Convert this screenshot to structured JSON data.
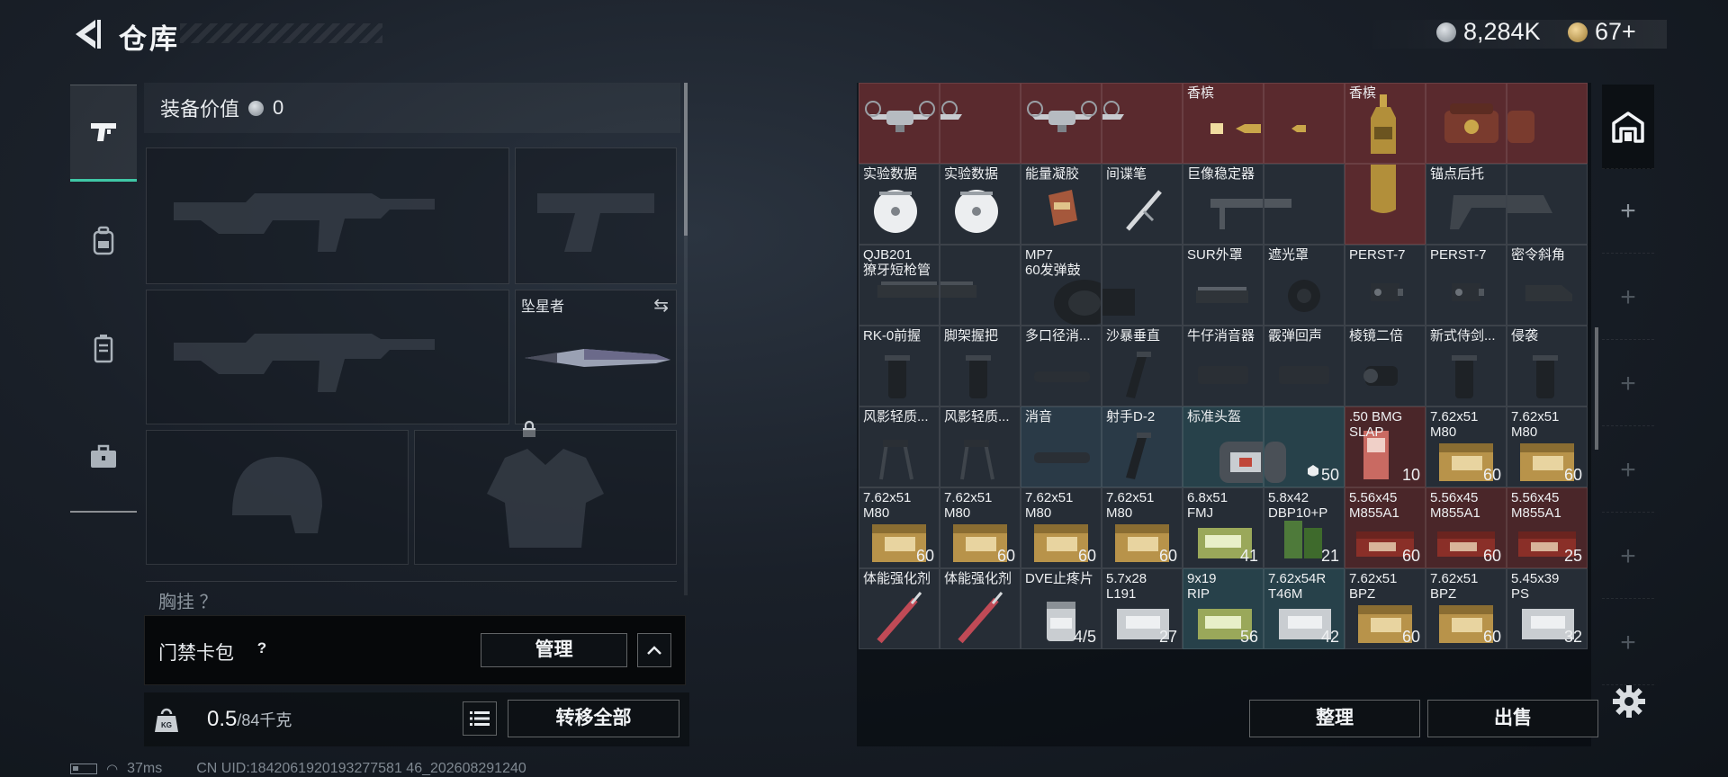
{
  "header": {
    "title": "仓库",
    "silver_amount": "8,284K",
    "gold_amount": "67+"
  },
  "nav": {
    "items": [
      {
        "icon": "pistol-icon",
        "active": true
      },
      {
        "icon": "backpack-icon",
        "active": false
      },
      {
        "icon": "vest-icon",
        "active": false
      },
      {
        "icon": "briefcase-icon",
        "active": false
      }
    ]
  },
  "loadout": {
    "equip_value_label": "装备价值",
    "equip_value": "0",
    "melee_name": "坠星者",
    "chest_rig_label": "胸挂 ？"
  },
  "keycard": {
    "label": "门禁卡包",
    "help": "?",
    "manage_label": "管理"
  },
  "weight": {
    "current": "0.5",
    "max": "/84千克"
  },
  "buttons": {
    "transfer_all": "转移全部",
    "sort": "整理",
    "sell": "出售"
  },
  "status": {
    "ping": "37ms",
    "uid": "CN UID:1842061920193277581 46_202608291240"
  },
  "stash": {
    "rows": [
      [
        {
          "name": "",
          "count": "",
          "bg": "red",
          "icon": "drone"
        },
        {
          "name": "",
          "count": "",
          "bg": "red",
          "icon": "drone-cont"
        },
        {
          "name": "",
          "count": "",
          "bg": "red",
          "icon": "drone"
        },
        {
          "name": "",
          "count": "",
          "bg": "red",
          "icon": "drone-cont"
        },
        {
          "name": "香槟",
          "count": "",
          "bg": "red",
          "icon": "bottle-h"
        },
        {
          "name": "",
          "count": "",
          "bg": "red",
          "icon": "bottle-h-cont"
        },
        {
          "name": "香槟",
          "count": "",
          "bg": "red",
          "icon": "bottle-v"
        },
        {
          "name": "",
          "count": "",
          "bg": "red",
          "icon": "box-red"
        },
        {
          "name": "",
          "count": "",
          "bg": "red",
          "icon": "box-red-cont"
        }
      ],
      [
        {
          "name": "实验数据",
          "count": "",
          "bg": "gray",
          "icon": "disc"
        },
        {
          "name": "实验数据",
          "count": "",
          "bg": "gray",
          "icon": "disc"
        },
        {
          "name": "能量凝胶",
          "count": "",
          "bg": "gray",
          "icon": "gel"
        },
        {
          "name": "间谍笔",
          "count": "",
          "bg": "gray",
          "icon": "pen"
        },
        {
          "name": "巨像稳定器",
          "count": "",
          "bg": "gray",
          "icon": "stabilizer"
        },
        {
          "name": "",
          "count": "",
          "bg": "gray",
          "icon": "stabilizer-cont"
        },
        {
          "name": "",
          "count": "",
          "bg": "red",
          "icon": "bottle-v-cont"
        },
        {
          "name": "锚点后托",
          "count": "",
          "bg": "gray",
          "icon": "stock"
        },
        {
          "name": "",
          "count": "",
          "bg": "gray",
          "icon": "stock-cont"
        }
      ],
      [
        {
          "name": "QJB201\n獠牙短枪管",
          "count": "",
          "bg": "gray",
          "icon": "handguard"
        },
        {
          "name": "",
          "count": "",
          "bg": "gray",
          "icon": "handguard-cont"
        },
        {
          "name": "MP7\n60发弹鼓",
          "count": "",
          "bg": "gray",
          "icon": "drum"
        },
        {
          "name": "",
          "count": "",
          "bg": "gray",
          "icon": "drum-cont"
        },
        {
          "name": "SUR外罩",
          "count": "",
          "bg": "gray",
          "icon": "rail"
        },
        {
          "name": "遮光罩",
          "count": "",
          "bg": "gray",
          "icon": "hood"
        },
        {
          "name": "PERST-7",
          "count": "",
          "bg": "gray",
          "icon": "laser"
        },
        {
          "name": "PERST-7",
          "count": "",
          "bg": "gray",
          "icon": "laser"
        },
        {
          "name": "密令斜角",
          "count": "",
          "bg": "gray",
          "icon": "angled"
        }
      ],
      [
        {
          "name": "RK-0前握",
          "count": "",
          "bg": "gray",
          "icon": "grip"
        },
        {
          "name": "脚架握把",
          "count": "",
          "bg": "gray",
          "icon": "grip"
        },
        {
          "name": "多口径消...",
          "count": "",
          "bg": "gray",
          "icon": "suppressor"
        },
        {
          "name": "沙暴垂直",
          "count": "",
          "bg": "gray",
          "icon": "vgrip"
        },
        {
          "name": "牛仔消音器",
          "count": "",
          "bg": "gray",
          "icon": "suppressor2"
        },
        {
          "name": "霰弹回声",
          "count": "",
          "bg": "gray",
          "icon": "suppressor2"
        },
        {
          "name": "棱镜二倍",
          "count": "",
          "bg": "gray",
          "icon": "scope"
        },
        {
          "name": "新式侍剑...",
          "count": "",
          "bg": "gray",
          "icon": "grip"
        },
        {
          "name": "侵袭",
          "count": "",
          "bg": "gray",
          "icon": "grip"
        }
      ],
      [
        {
          "name": "风影轻质...",
          "count": "",
          "bg": "gray",
          "icon": "bipod"
        },
        {
          "name": "风影轻质...",
          "count": "",
          "bg": "gray",
          "icon": "bipod"
        },
        {
          "name": "消音",
          "count": "",
          "bg": "blue",
          "icon": "suppressor"
        },
        {
          "name": "射手D-2",
          "count": "",
          "bg": "blue",
          "icon": "vgrip"
        },
        {
          "name": "标准头盔",
          "count": "",
          "bg": "teal",
          "icon": "helmet-bag"
        },
        {
          "name": "",
          "count": "50",
          "bg": "teal",
          "icon": "helmet-bag-cont"
        },
        {
          "name": ".50 BMG\nSLAP",
          "count": "10",
          "bg": "darkred",
          "icon": "ammo-red"
        },
        {
          "name": "7.62x51\nM80",
          "count": "60",
          "bg": "gray",
          "icon": "ammo-gold"
        },
        {
          "name": "7.62x51\nM80",
          "count": "60",
          "bg": "gray",
          "icon": "ammo-gold"
        }
      ],
      [
        {
          "name": "7.62x51\nM80",
          "count": "60",
          "bg": "gray",
          "icon": "ammo-gold"
        },
        {
          "name": "7.62x51\nM80",
          "count": "60",
          "bg": "gray",
          "icon": "ammo-gold"
        },
        {
          "name": "7.62x51\nM80",
          "count": "60",
          "bg": "gray",
          "icon": "ammo-gold"
        },
        {
          "name": "7.62x51\nM80",
          "count": "60",
          "bg": "gray",
          "icon": "ammo-gold"
        },
        {
          "name": "6.8x51\nFMJ",
          "count": "41",
          "bg": "gray",
          "icon": "ammo-green"
        },
        {
          "name": "5.8x42\nDBP10+P",
          "count": "21",
          "bg": "gray",
          "icon": "ammo-green2"
        },
        {
          "name": "5.56x45\nM855A1",
          "count": "60",
          "bg": "darkred",
          "icon": "ammo-red2"
        },
        {
          "name": "5.56x45\nM855A1",
          "count": "60",
          "bg": "darkred",
          "icon": "ammo-red2"
        },
        {
          "name": "5.56x45\nM855A1",
          "count": "25",
          "bg": "darkred",
          "icon": "ammo-red2"
        }
      ],
      [
        {
          "name": "体能强化剂",
          "count": "",
          "bg": "gray",
          "icon": "injector"
        },
        {
          "name": "体能强化剂",
          "count": "",
          "bg": "gray",
          "icon": "injector"
        },
        {
          "name": "DVE止疼片",
          "count": "4/5",
          "bg": "gray",
          "icon": "pills"
        },
        {
          "name": "5.7x28\nL191",
          "count": "27",
          "bg": "gray",
          "icon": "ammo-silver"
        },
        {
          "name": "9x19\nRIP",
          "count": "56",
          "bg": "teal",
          "icon": "ammo-green"
        },
        {
          "name": "7.62x54R\nT46M",
          "count": "42",
          "bg": "teal",
          "icon": "ammo-silver"
        },
        {
          "name": "7.62x51\nBPZ",
          "count": "60",
          "bg": "gray",
          "icon": "ammo-gold"
        },
        {
          "name": "7.62x51\nBPZ",
          "count": "60",
          "bg": "gray",
          "icon": "ammo-gold"
        },
        {
          "name": "5.45x39\nPS",
          "count": "32",
          "bg": "gray",
          "icon": "ammo-silver"
        }
      ]
    ]
  },
  "colors": {
    "accent": "#3fc7a6",
    "rare_red": "#5a2a2e",
    "epic_blue": "#2a3a47",
    "cell_gray": "#262d36"
  }
}
